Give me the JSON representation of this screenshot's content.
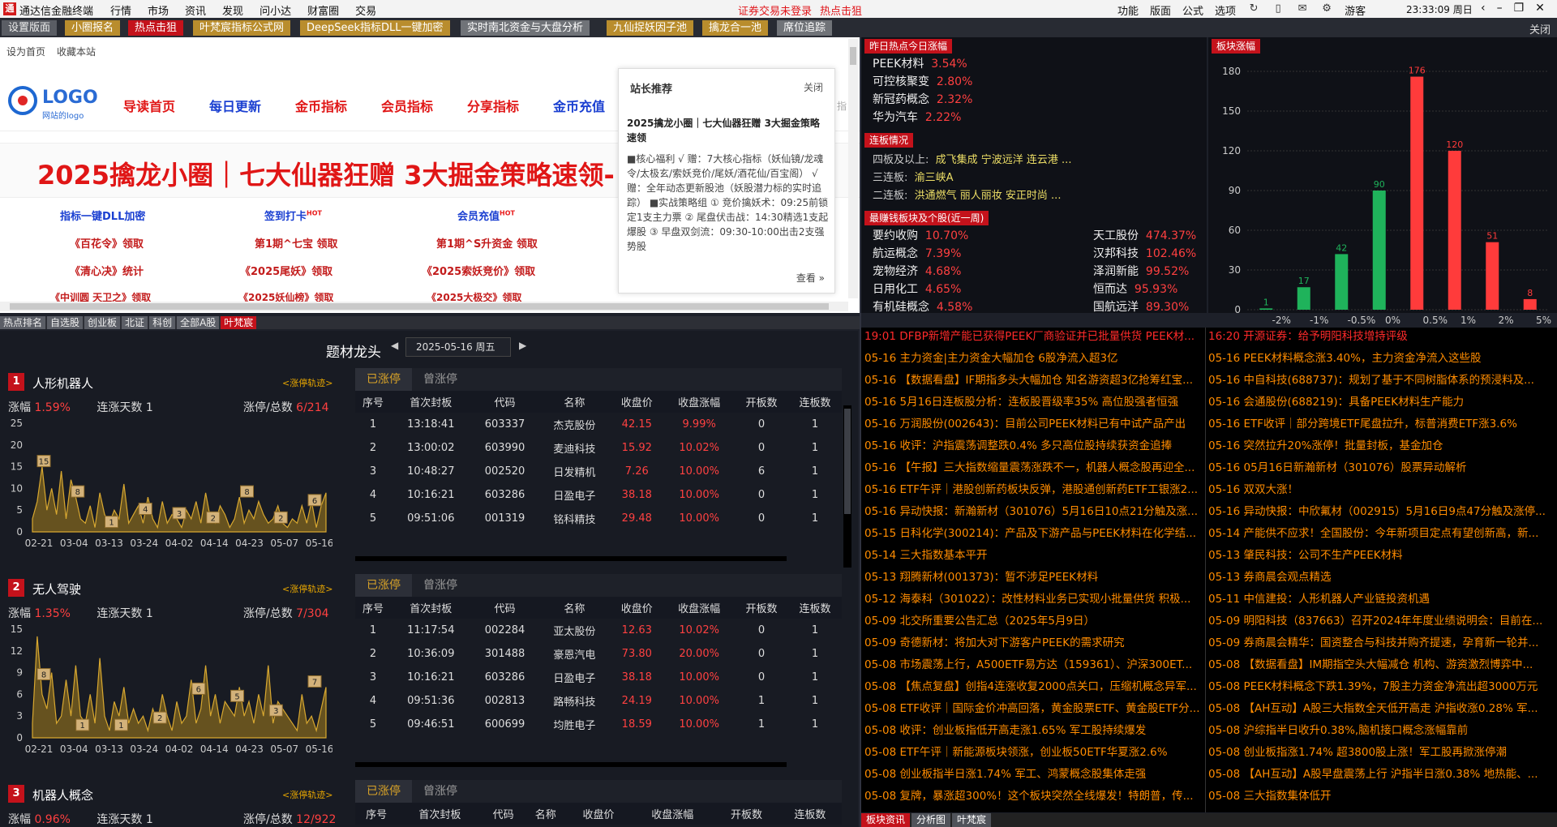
{
  "titlebar": {
    "app_name": "通达信金融终端",
    "menu": [
      "行情",
      "市场",
      "资讯",
      "发现",
      "问小达",
      "财富圈",
      "交易"
    ],
    "warn1": "证券交易未登录",
    "warn2": "热点击狙",
    "right": [
      "功能",
      "版面",
      "公式",
      "选项"
    ],
    "user": "游客",
    "clock": "23:33:09 周日"
  },
  "tabs": [
    {
      "label": "设置版面"
    },
    {
      "label": "小圈报名"
    },
    {
      "label": "热点击狙"
    },
    {
      "label": "叶梵宸指标公式网"
    },
    {
      "label": "DeepSeek指标DLL一键加密"
    },
    {
      "label": "实时南北资金与大盘分析"
    },
    {
      "label": "九仙捉妖因子池"
    },
    {
      "label": "擒龙合一池"
    },
    {
      "label": "席位追踪"
    }
  ],
  "tab_close": "关闭",
  "browser": {
    "set_home": "设为首页",
    "bookmark": "收藏本站",
    "logo": "LOGO",
    "logo_sub": "网站的logo",
    "nav": [
      "导读首页",
      "每日更新",
      "金币指标",
      "会员指标",
      "分享指标",
      "金币充值"
    ],
    "nav_more": "指",
    "banner": "2025擒龙小圈｜七大仙器狂赠 3大掘金策略速领-",
    "links": [
      [
        "指标一键DLL加密",
        "签到打卡",
        "会员充值"
      ],
      [
        "《百花令》领取",
        "第1期^七宝 领取",
        "第1期^S升资金 领取"
      ],
      [
        "《清心决》统计",
        "《2025尾妖》领取",
        "《2025索妖竞价》领取"
      ],
      [
        "《中训圆 天卫之》领取",
        "《2025妖仙榜》领取",
        "《2025大极交》领取"
      ]
    ],
    "hot": "HOT"
  },
  "popup": {
    "title": "站长推荐",
    "close": "关闭",
    "headline": "2025擒龙小圈｜七大仙器狂赠 3大掘金策略速领",
    "body": "■核心福利 √ 赠：7大核心指标（妖仙镜/龙魂令/太极玄/索妖竞价/尾妖/酒花仙/百宝阁） √ 赠：全年动态更新股池（妖股潜力标的实时追踪） ■实战策略组 ① 竞价擒妖术：09:25前锁定1支主力票 ② 尾盘伏击战：14:30精选1支起爆股 ③ 早盘双剑流：09:30-10:00出击2支强势股",
    "more": "查看 »"
  },
  "subtabs": [
    "热点排名",
    "自选股",
    "创业板",
    "北证",
    "科创",
    "全部A股",
    "叶梵宸"
  ],
  "themes": {
    "title": "题材龙头",
    "date": "2025-05-16 周五",
    "track": "<涨停轨迹>",
    "tab_on": "已涨停",
    "tab_off": "曾涨停",
    "lbl_chg": "涨幅",
    "lbl_days": "连涨天数",
    "lbl_ratio": "涨停/总数",
    "columns": [
      "序号",
      "首次封板",
      "代码",
      "名称",
      "收盘价",
      "收盘涨幅",
      "开板数",
      "连板数"
    ],
    "dates": [
      "02-21",
      "03-04",
      "03-13",
      "03-24",
      "04-02",
      "04-14",
      "04-23",
      "05-07",
      "05-16"
    ],
    "blocks": [
      {
        "num": "1",
        "name": "人形机器人",
        "chg": "1.59%",
        "days": "1",
        "ratio": "6/214",
        "yticks": [
          "25",
          "20",
          "15",
          "10",
          "5",
          "0"
        ],
        "ymax": 25,
        "labels": [
          15,
          8,
          1,
          4,
          3,
          2,
          8,
          2,
          6
        ],
        "series": [
          3,
          7,
          15,
          5,
          10,
          4,
          14,
          3,
          12,
          8,
          3,
          2,
          6,
          1,
          9,
          4,
          2,
          5,
          3,
          11,
          2,
          4,
          6,
          2,
          8,
          3,
          1,
          7,
          2,
          4,
          3,
          1,
          5,
          3,
          7,
          2,
          9,
          3,
          2,
          6,
          4,
          1,
          3,
          8,
          2,
          5,
          3,
          7,
          4,
          2,
          3,
          6,
          2,
          1,
          3,
          2,
          6,
          2,
          7,
          1,
          6,
          9
        ],
        "rows": [
          [
            "1",
            "13:18:41",
            "603337",
            "杰克股份",
            "42.15",
            "9.99%",
            "0",
            "1"
          ],
          [
            "2",
            "13:00:02",
            "603990",
            "麦迪科技",
            "15.92",
            "10.02%",
            "0",
            "1"
          ],
          [
            "3",
            "10:48:27",
            "002520",
            "日发精机",
            "7.26",
            "10.00%",
            "6",
            "1"
          ],
          [
            "4",
            "10:16:21",
            "603286",
            "日盈电子",
            "38.18",
            "10.00%",
            "0",
            "1"
          ],
          [
            "5",
            "09:51:06",
            "001319",
            "铭科精技",
            "29.48",
            "10.00%",
            "0",
            "1"
          ]
        ]
      },
      {
        "num": "2",
        "name": "无人驾驶",
        "chg": "1.35%",
        "days": "1",
        "ratio": "7/304",
        "yticks": [
          "15",
          "12",
          "9",
          "6",
          "3",
          "0"
        ],
        "ymax": 15,
        "labels": [
          8,
          1,
          1,
          2,
          6,
          5,
          3,
          7
        ],
        "series": [
          2,
          14,
          6,
          4,
          9,
          2,
          3,
          8,
          3,
          10,
          3,
          2,
          6,
          2,
          11,
          3,
          1,
          5,
          3,
          7,
          2,
          4,
          2,
          3,
          1,
          4,
          2,
          6,
          3,
          1,
          5,
          2,
          3,
          8,
          2,
          4,
          10,
          3,
          6,
          2,
          5,
          4,
          3,
          7,
          3,
          5,
          2,
          6,
          3,
          10,
          2,
          5,
          4,
          3,
          2,
          1,
          6,
          2,
          3,
          1,
          4,
          7
        ],
        "rows": [
          [
            "1",
            "11:17:54",
            "002284",
            "亚太股份",
            "12.63",
            "10.02%",
            "0",
            "1"
          ],
          [
            "2",
            "10:36:09",
            "301488",
            "豪恩汽电",
            "73.80",
            "20.00%",
            "0",
            "1"
          ],
          [
            "3",
            "10:16:21",
            "603286",
            "日盈电子",
            "38.18",
            "10.00%",
            "0",
            "1"
          ],
          [
            "4",
            "09:51:36",
            "002813",
            "路畅科技",
            "24.19",
            "10.00%",
            "1",
            "1"
          ],
          [
            "5",
            "09:46:51",
            "600699",
            "均胜电子",
            "18.59",
            "10.00%",
            "1",
            "1"
          ]
        ]
      },
      {
        "num": "3",
        "name": "机器人概念",
        "chg": "0.96%",
        "days": "1",
        "ratio": "12/922",
        "rows": []
      }
    ]
  },
  "limitup": {
    "title": "昨日热点今日涨幅",
    "items": [
      {
        "name": "PEEK材料",
        "pct": "3.54%"
      },
      {
        "name": "可控核聚变",
        "pct": "2.80%"
      },
      {
        "name": "新冠药概念",
        "pct": "2.32%"
      },
      {
        "name": "华为汽车",
        "pct": "2.22%"
      }
    ],
    "board_title": "连板情况",
    "boards": [
      {
        "lvl": "四板及以上:",
        "names": "成飞集成  宁波远洋  连云港     ..."
      },
      {
        "lvl": "三连板:",
        "names": "渝三峡A"
      },
      {
        "lvl": "二连板:",
        "names": "洪通燃气  丽人丽妆  安正时尚     ..."
      }
    ],
    "profit_title": "最赚钱板块及个股(近一周)",
    "sectors": [
      {
        "name": "要约收购",
        "pct": "10.70%"
      },
      {
        "name": "航运概念",
        "pct": "7.39%"
      },
      {
        "name": "宠物经济",
        "pct": "4.68%"
      },
      {
        "name": "日用化工",
        "pct": "4.65%"
      },
      {
        "name": "有机硅概念",
        "pct": "4.58%"
      }
    ],
    "stocks": [
      {
        "name": "天工股份",
        "pct": "474.37%"
      },
      {
        "name": "汉邦科技",
        "pct": "102.46%"
      },
      {
        "name": "泽润新能",
        "pct": "99.52%"
      },
      {
        "name": "恒而达",
        "pct": "95.93%"
      },
      {
        "name": "国航远洋",
        "pct": "89.30%"
      }
    ]
  },
  "chart_data": {
    "type": "bar",
    "title": "板块涨幅",
    "categories": [
      "-2%",
      "-1%",
      "-0.5%",
      "0%",
      "0.5%",
      "1%",
      "2%",
      "5%"
    ],
    "values": [
      1,
      17,
      42,
      90,
      176,
      120,
      51,
      8
    ],
    "colors": [
      "#1fb35b",
      "#1fb35b",
      "#1fb35b",
      "#1fb35b",
      "#ff3b3b",
      "#ff3b3b",
      "#ff3b3b",
      "#ff3b3b"
    ],
    "ylim": [
      0,
      180
    ],
    "yticks": [
      0,
      30,
      60,
      90,
      120,
      150,
      180
    ]
  },
  "news": {
    "left": [
      {
        "t": "19:01 DFBP新增产能已获得PEEK厂商验证并已批量供货 PEEK材...",
        "red": true
      },
      {
        "t": "05-16 主力资金|主力资金大幅加仓 6股净流入超3亿"
      },
      {
        "t": "05-16 【数据看盘】IF期指多头大幅加仓 知名游资超3亿抢筹红宝..."
      },
      {
        "t": "05-16 5月16日连板股分析：连板股晋级率35% 高位股强者恒强"
      },
      {
        "t": "05-16 万润股份(002643)：目前公司PEEK材料已有中试产品产出"
      },
      {
        "t": "05-16 收评：沪指震荡调整跌0.4% 多只高位股持续获资金追捧"
      },
      {
        "t": "05-16 【午报】三大指数缩量震荡涨跌不一，机器人概念股再迎全..."
      },
      {
        "t": "05-16 ETF午评｜港股创新药板块反弹，港股通创新药ETF工银涨2..."
      },
      {
        "t": "05-16 异动快报：新瀚新材（301076）5月16日10点21分触及涨..."
      },
      {
        "t": "05-15 日科化学(300214)：产品及下游产品与PEEK材料在化学结..."
      },
      {
        "t": "05-14 三大指数基本平开"
      },
      {
        "t": "05-13 翔腾新材(001373)：暂不涉足PEEK材料"
      },
      {
        "t": "05-12 海泰科（301022）：改性材料业务已实现小批量供货 积极..."
      },
      {
        "t": "05-09 北交所重要公告汇总（2025年5月9日）"
      },
      {
        "t": "05-09 奇德新材：将加大对下游客户PEEK的需求研究"
      },
      {
        "t": "05-08 市场震荡上行，A500ETF易方达（159361）、沪深300ET..."
      },
      {
        "t": "05-08 【焦点复盘】创指4连涨收复2000点关口，压缩机概念异军..."
      },
      {
        "t": "05-08 ETF收评｜国际金价冲高回落，黄金股票ETF、黄金股ETF分..."
      },
      {
        "t": "05-08 收评：创业板指低开高走涨1.65% 军工股持续爆发"
      },
      {
        "t": "05-08 ETF午评｜新能源板块领涨，创业板50ETF华夏涨2.6%"
      },
      {
        "t": "05-08 创业板指半日涨1.74% 军工、鸿蒙概念股集体走强"
      },
      {
        "t": "05-08 复牌，暴涨超300%！这个板块突然全线爆发！特朗普，传..."
      }
    ],
    "right": [
      {
        "t": "16:20 开源证券：给予明阳科技增持评级",
        "red": true
      },
      {
        "t": "05-16 PEEK材料概念涨3.40%，主力资金净流入这些股"
      },
      {
        "t": "05-16 中自科技(688737)：规划了基于不同树脂体系的预浸料及..."
      },
      {
        "t": "05-16 会通股份(688219)：具备PEEK材料生产能力"
      },
      {
        "t": "05-16 ETF收评｜部分跨境ETF尾盘拉升，标普消费ETF涨3.6%"
      },
      {
        "t": "05-16 突然拉升20%涨停！批量封板，基金加仓"
      },
      {
        "t": "05-16 05月16日新瀚新材（301076）股票异动解析"
      },
      {
        "t": "05-16 双双大涨！"
      },
      {
        "t": "05-16 异动快报：中欣氟材（002915）5月16日9点47分触及涨停..."
      },
      {
        "t": "05-14 产能供不应求！全国股份：今年新项目定点有望创新高，新..."
      },
      {
        "t": "05-13 肇民科技：公司不生产PEEK材料"
      },
      {
        "t": "05-13 券商晨会观点精选"
      },
      {
        "t": "05-11 中信建投：人形机器人产业链投资机遇"
      },
      {
        "t": "05-09 明阳科技（837663）召开2024年年度业绩说明会：目前在..."
      },
      {
        "t": "05-09 券商晨会精华：国资整合与科技并购齐提速，孕育新一轮并..."
      },
      {
        "t": "05-08 【数据看盘】IM期指空头大幅减仓 机构、游资激烈博弈中..."
      },
      {
        "t": "05-08 PEEK材料概念下跌1.39%，7股主力资金净流出超3000万元"
      },
      {
        "t": "05-08 【AH互动】A股三大指数全天低开高走 沪指收涨0.28% 军..."
      },
      {
        "t": "05-08 沪综指半日收升0.38%,脑机接口概念涨幅靠前"
      },
      {
        "t": "05-08 创业板指涨1.74% 超3800股上涨！军工股再掀涨停潮"
      },
      {
        "t": "05-08 【AH互动】A股早盘震荡上行 沪指半日涨0.38% 地热能、..."
      },
      {
        "t": "05-08 三大指数集体低开"
      }
    ]
  },
  "newstabs": [
    "板块资讯",
    "分析图",
    "叶梵宸"
  ]
}
